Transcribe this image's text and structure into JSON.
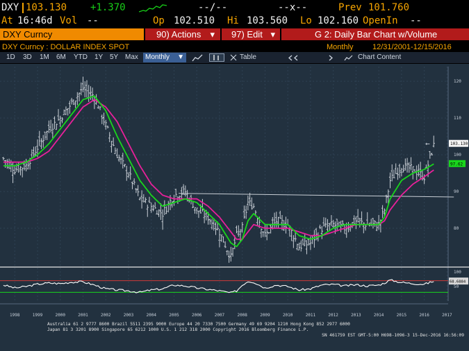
{
  "header": {
    "ticker": "DXY",
    "price": "103.130",
    "change": "+1.370",
    "dash1": "--/--",
    "dash2": "--x--",
    "prev_label": "Prev",
    "prev_value": "101.760",
    "at_label": "At",
    "time": "16:46d",
    "vol_label": "Vol",
    "vol_value": "--",
    "op_label": "Op",
    "op_value": "102.510",
    "hi_label": "Hi",
    "hi_value": "103.560",
    "lo_label": "Lo",
    "lo_value": "102.160",
    "openint_label": "OpenIn",
    "openint_value": "--"
  },
  "command_bar": {
    "security": "DXY Curncy",
    "actions": "90) Actions",
    "edit": "97) Edit",
    "title": "G 2: Daily Bar Chart w/Volume"
  },
  "subheader": {
    "security_name": "DXY Curncy : DOLLAR INDEX SPOT",
    "period": "Monthly",
    "range": "12/31/2001-12/15/2016"
  },
  "toolbar": {
    "ranges": [
      "1D",
      "3D",
      "1M",
      "6M",
      "YTD",
      "1Y",
      "5Y",
      "Max"
    ],
    "frequency": "Monthly",
    "table_label": "Table",
    "chart_content_label": "Chart Content"
  },
  "colors": {
    "background": "#22313f",
    "price_bars": "#c9cfd6",
    "ma_fast": "#19d61c",
    "ma_slow": "#e8209a",
    "rsi_line": "#ffffff",
    "rsi_overbought": "#d03a3a",
    "rsi_oversold": "#19d61c",
    "last_price_tag": "#f5f5f5",
    "ma_tag": "#19d61c"
  },
  "chart_data": [
    {
      "type": "bar",
      "title": "DXY Curncy : DOLLAR INDEX SPOT",
      "frequency": "Monthly",
      "yticks": [
        80,
        90,
        100,
        110,
        120
      ],
      "ylim": [
        70,
        124
      ],
      "xticks": [
        "1998",
        "1999",
        "2000",
        "2001",
        "2002",
        "2003",
        "2004",
        "2005",
        "2006",
        "2007",
        "2008",
        "2009",
        "2010",
        "2011",
        "2012",
        "2013",
        "2014",
        "2015",
        "2016",
        "2017"
      ],
      "last_price_label": "103.130",
      "ma_label": "97.62",
      "series": [
        {
          "name": "close",
          "x": [
            1998,
            1998.5,
            1999,
            1999.5,
            2000,
            2000.5,
            2001,
            2001.5,
            2002,
            2002.5,
            2003,
            2003.5,
            2004,
            2004.5,
            2005,
            2005.5,
            2006,
            2006.5,
            2007,
            2007.5,
            2008,
            2008.25,
            2008.5,
            2008.75,
            2009,
            2009.5,
            2010,
            2010.5,
            2011,
            2011.5,
            2012,
            2012.5,
            2013,
            2013.5,
            2014,
            2014.5,
            2014.75,
            2015,
            2015.5,
            2016,
            2016.5,
            2016.95
          ],
          "values": [
            99,
            96,
            97,
            102,
            107,
            110,
            114,
            118,
            116,
            108,
            100,
            95,
            88,
            86,
            84,
            89,
            90,
            85,
            83,
            79,
            72,
            78,
            80,
            87,
            86,
            78,
            82,
            81,
            75,
            76,
            80,
            81,
            80,
            82,
            81,
            81,
            85,
            93,
            97,
            96,
            94,
            103.1
          ]
        },
        {
          "name": "moving_average_fast",
          "values": [
            97,
            97,
            98,
            100,
            103,
            107,
            111,
            115,
            116,
            112,
            105,
            99,
            93,
            89,
            86,
            87,
            88,
            87,
            84,
            81,
            76,
            75,
            77,
            82,
            84,
            81,
            81,
            81,
            78,
            77,
            78,
            80,
            81,
            81,
            81,
            81,
            83,
            88,
            93,
            95,
            96,
            97.6
          ]
        },
        {
          "name": "moving_average_slow",
          "values": [
            98,
            98,
            98,
            99,
            101,
            105,
            109,
            113,
            115,
            113,
            109,
            103,
            97,
            92,
            89,
            88,
            88,
            88,
            86,
            83,
            79,
            77,
            77,
            79,
            81,
            80,
            80,
            80,
            79,
            78,
            78,
            79,
            80,
            81,
            81,
            81,
            82,
            85,
            89,
            92,
            94,
            96
          ]
        }
      ],
      "trendline": {
        "from": [
          2005.7,
          89.5
        ],
        "to": [
          2017.8,
          88.5
        ]
      }
    },
    {
      "type": "line",
      "title": "RSI",
      "yticks": [
        50,
        100
      ],
      "ylim": [
        0,
        100
      ],
      "overbought": 70,
      "oversold": 30,
      "last_value_label": "68.6884",
      "series": [
        {
          "name": "rsi",
          "x": [
            1998,
            1998.5,
            1999,
            1999.5,
            2000,
            2000.5,
            2001,
            2001.5,
            2002,
            2002.5,
            2003,
            2003.5,
            2004,
            2004.5,
            2005,
            2005.5,
            2006,
            2006.5,
            2007,
            2007.5,
            2008,
            2008.25,
            2008.5,
            2008.75,
            2009,
            2009.5,
            2010,
            2010.5,
            2011,
            2011.5,
            2012,
            2012.5,
            2013,
            2013.5,
            2014,
            2014.5,
            2014.75,
            2015,
            2015.5,
            2016,
            2016.5,
            2016.95
          ],
          "values": [
            55,
            45,
            50,
            58,
            62,
            60,
            65,
            66,
            55,
            42,
            38,
            35,
            30,
            38,
            42,
            55,
            52,
            45,
            40,
            35,
            28,
            35,
            55,
            68,
            65,
            45,
            55,
            50,
            38,
            42,
            55,
            57,
            52,
            56,
            52,
            55,
            62,
            72,
            64,
            60,
            58,
            68.7
          ]
        }
      ]
    }
  ],
  "footer": {
    "line1": "Australia 61 2 9777 8600 Brazil 5511 2395 9000 Europe 44 20 7330 7500 Germany 49 69 9204 1210 Hong Kong 852 2977 6000",
    "line2": "Japan 81 3 3201 8900         Singapore 65 6212 1000         U.S. 1 212 318 2000         Copyright 2016 Bloomberg Finance L.P.",
    "line3": "SN 461759 EST  GMT-5:00 H698-1096-3 15-Dec-2016 16:56:09"
  }
}
